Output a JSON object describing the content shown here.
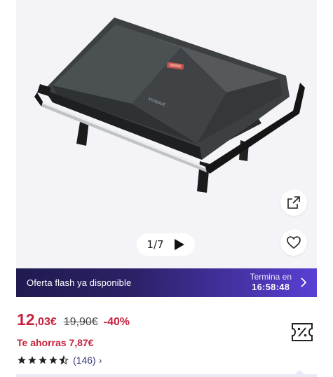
{
  "gallery": {
    "counter": "1/7",
    "brand_on_product": "MYWAVE",
    "icons": {
      "share": "open-external-icon",
      "favorite": "heart-icon",
      "play": "play-icon"
    }
  },
  "flash": {
    "text": "Oferta flash ya disponible",
    "ends_label": "Termina en",
    "countdown": "16:58:48",
    "icon": "chevron-right-icon",
    "colors": {
      "start": "#1f1b50",
      "end": "#5a3fd4"
    }
  },
  "price": {
    "integer": "12",
    "decimal": ",03€",
    "old": "19,90€",
    "discount": "-40%",
    "savings": "Te ahorras 7,87€",
    "accent_color": "#c6223d"
  },
  "rating": {
    "stars": 4.5,
    "count": "(146)",
    "chevron": "›"
  },
  "coupon": {
    "icon": "discount-ticket-icon"
  }
}
